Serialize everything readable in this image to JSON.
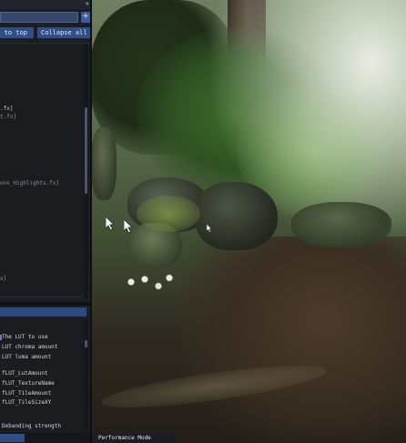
{
  "toolbar": {
    "move_to_top_label": "ve to top",
    "collapse_all_label": "Collapse all",
    "add_symbol": "+",
    "close_symbol": "×"
  },
  "effects": {
    "items": [
      {
        "text": ".fx]",
        "dim": false
      },
      {
        "text": "t.fx]",
        "dim": true
      },
      {
        "text": "ons_Highlights.fx]",
        "dim": true
      },
      {
        "text": "x]",
        "dim": true
      }
    ]
  },
  "params_panel": {
    "items": [
      {
        "text": "The LUT to use"
      },
      {
        "text": "LUT chroma amount"
      },
      {
        "text": "LUT luma amount"
      },
      {
        "text": "fLUT_LutAmount"
      },
      {
        "text": "fLUT_TextureName"
      },
      {
        "text": "fLUT_TileAmount"
      },
      {
        "text": "fLUT_TileSizeXY"
      },
      {
        "text": "Debanding strength"
      }
    ]
  },
  "footer": {
    "performance_mode_label": "Performance Mode"
  },
  "icons": [
    "close-icon",
    "add-icon",
    "mouse-cursor-icon"
  ],
  "colors": {
    "accent": "#2f4f86",
    "panel_bg": "#1a1c20"
  }
}
